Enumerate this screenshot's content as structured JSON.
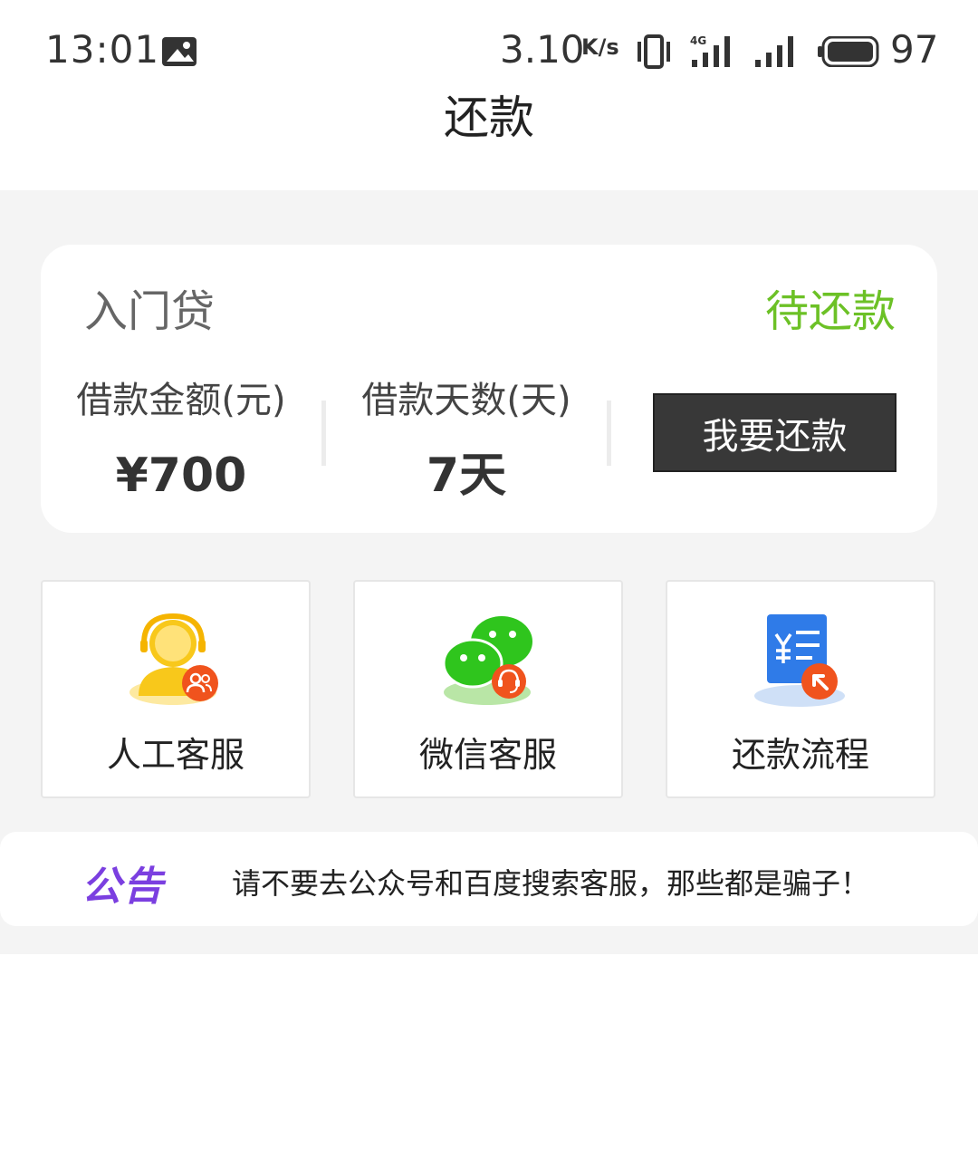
{
  "status_bar": {
    "time": "13:01",
    "net_speed": "3.10",
    "net_unit": "K/s",
    "battery": "97",
    "icons": [
      "gallery-icon",
      "vibrate-icon",
      "signal-4g-icon",
      "signal-icon",
      "battery-icon"
    ]
  },
  "header": {
    "title": "还款"
  },
  "loan": {
    "name": "入门贷",
    "status": "待还款",
    "status_color": "#6cc126",
    "amount_label": "借款金额(元)",
    "amount_value": "¥700",
    "days_label": "借款天数(天)",
    "days_value": "7天",
    "repay_button": "我要还款"
  },
  "tiles": [
    {
      "label": "人工客服",
      "icon": "customer-service-icon"
    },
    {
      "label": "微信客服",
      "icon": "wechat-icon"
    },
    {
      "label": "还款流程",
      "icon": "repay-process-icon"
    }
  ],
  "notice": {
    "tag": "公告",
    "text": "请不要去公众号和百度搜索客服，那些都是骗子！"
  }
}
